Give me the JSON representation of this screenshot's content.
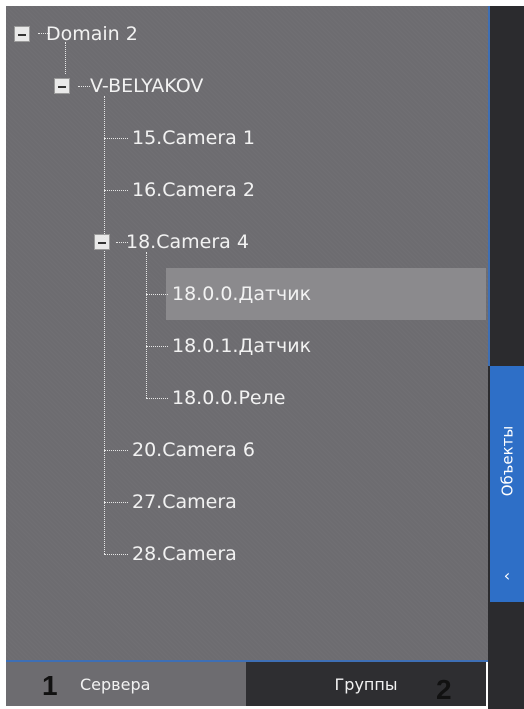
{
  "tree": {
    "domain": "Domain 2",
    "server": "V-BELYAKOV",
    "cameras_top": [
      "15.Camera 1",
      "16.Camera 2"
    ],
    "expanded_camera": "18.Camera 4",
    "sensors": [
      "18.0.0.Датчик",
      "18.0.1.Датчик",
      "18.0.0.Реле"
    ],
    "cameras_bottom": [
      "20.Camera 6",
      "27.Camera",
      "28.Camera"
    ],
    "selected_item": "18.0.0.Датчик"
  },
  "side_panel": {
    "objects_label": "Объекты",
    "arrow": "‹"
  },
  "tabs": {
    "servers": "Сервера",
    "groups": "Группы"
  },
  "markers": {
    "one": "1",
    "two": "2"
  },
  "colors": {
    "panel_bg": "#6d6c70",
    "accent": "#2e6fc7",
    "selected_bg": "#8b8a8d"
  }
}
